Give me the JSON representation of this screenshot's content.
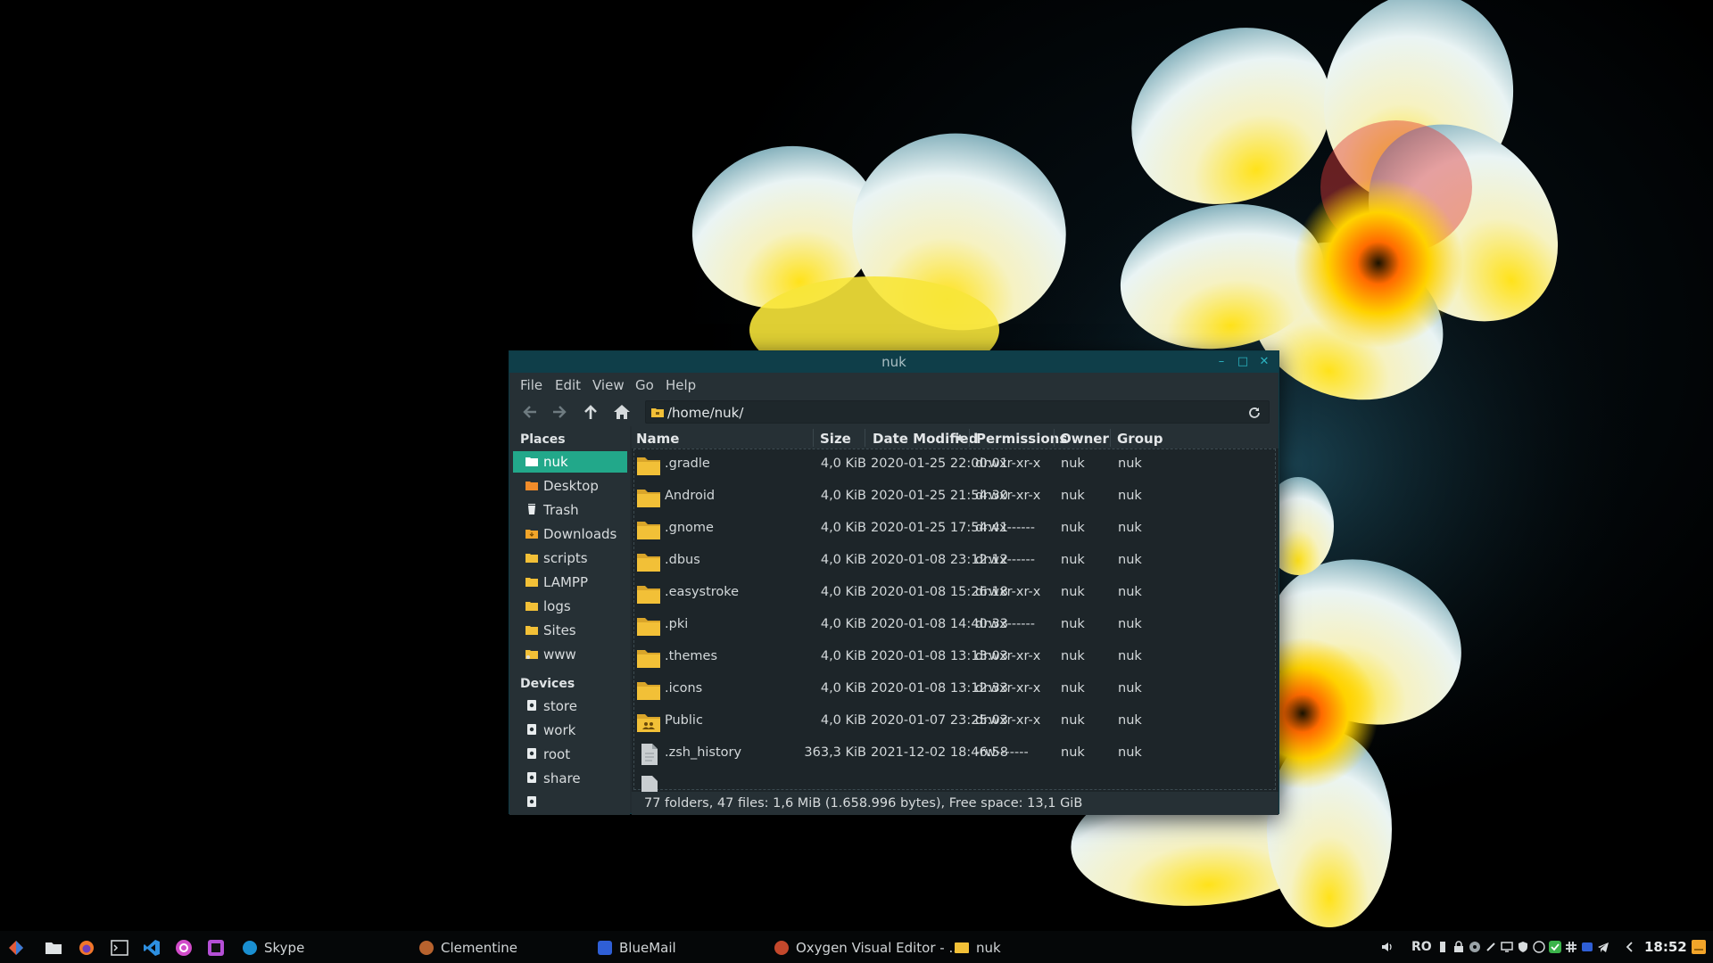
{
  "window": {
    "title": "nuk",
    "menu": [
      "File",
      "Edit",
      "View",
      "Go",
      "Help"
    ],
    "path": "/home/nuk/",
    "places_header": "Places",
    "places": [
      "nuk",
      "Desktop",
      "Trash",
      "Downloads",
      "scripts",
      "LAMPP",
      "logs",
      "Sites",
      "www"
    ],
    "devices_header": "Devices",
    "devices": [
      "store",
      "work",
      "root",
      "share"
    ],
    "columns": [
      "Name",
      "Size",
      "Date Modified",
      "Permissions",
      "Owner",
      "Group"
    ],
    "rows": [
      {
        "name": ".gradle",
        "size": "4,0 KiB",
        "date": "2020-01-25 22:00:01",
        "perm": "drwxr-xr-x",
        "owner": "nuk",
        "group": "nuk",
        "icon": "folder-icon"
      },
      {
        "name": "Android",
        "size": "4,0 KiB",
        "date": "2020-01-25 21:54:30",
        "perm": "drwxr-xr-x",
        "owner": "nuk",
        "group": "nuk",
        "icon": "folder-icon"
      },
      {
        "name": ".gnome",
        "size": "4,0 KiB",
        "date": "2020-01-25 17:54:41",
        "perm": "drwx------",
        "owner": "nuk",
        "group": "nuk",
        "icon": "folder-icon"
      },
      {
        "name": ".dbus",
        "size": "4,0 KiB",
        "date": "2020-01-08 23:12:12",
        "perm": "drwx------",
        "owner": "nuk",
        "group": "nuk",
        "icon": "folder-icon"
      },
      {
        "name": ".easystroke",
        "size": "4,0 KiB",
        "date": "2020-01-08 15:26:18",
        "perm": "drwxr-xr-x",
        "owner": "nuk",
        "group": "nuk",
        "icon": "folder-icon"
      },
      {
        "name": ".pki",
        "size": "4,0 KiB",
        "date": "2020-01-08 14:40:33",
        "perm": "drwx------",
        "owner": "nuk",
        "group": "nuk",
        "icon": "folder-icon"
      },
      {
        "name": ".themes",
        "size": "4,0 KiB",
        "date": "2020-01-08 13:13:03",
        "perm": "drwxr-xr-x",
        "owner": "nuk",
        "group": "nuk",
        "icon": "folder-icon"
      },
      {
        "name": ".icons",
        "size": "4,0 KiB",
        "date": "2020-01-08 13:12:33",
        "perm": "drwxr-xr-x",
        "owner": "nuk",
        "group": "nuk",
        "icon": "folder-icon"
      },
      {
        "name": "Public",
        "size": "4,0 KiB",
        "date": "2020-01-07 23:25:03",
        "perm": "drwxr-xr-x",
        "owner": "nuk",
        "group": "nuk",
        "icon": "folder-public-icon"
      },
      {
        "name": ".zsh_history",
        "size": "363,3 KiB",
        "date": "2021-12-02 18:46:58",
        "perm": "-rw-------",
        "owner": "nuk",
        "group": "nuk",
        "icon": "file-icon"
      }
    ],
    "status": "77 folders, 47 files: 1,6 MiB (1.658.996 bytes), Free space: 13,1 GiB"
  },
  "taskbar": {
    "tasks": [
      {
        "label": "Skype",
        "icon": "skype-icon",
        "color": "#1a8fd1"
      },
      {
        "label": "Clementine",
        "icon": "clementine-icon",
        "color": "#b8632e"
      },
      {
        "label": "BlueMail",
        "icon": "bluemail-icon",
        "color": "#2f5fd6"
      },
      {
        "label": "Oxygen Visual Editor - ...",
        "icon": "oxygen-icon",
        "color": "#c4482c"
      },
      {
        "label": "nuk",
        "icon": "folder-icon",
        "color": "#f2c037"
      }
    ],
    "keyboard_layout": "RO",
    "clock": "18:52"
  },
  "colors": {
    "accent": "#22a88a",
    "titlebar": "#0f3e49",
    "folder": "#f2c037"
  }
}
